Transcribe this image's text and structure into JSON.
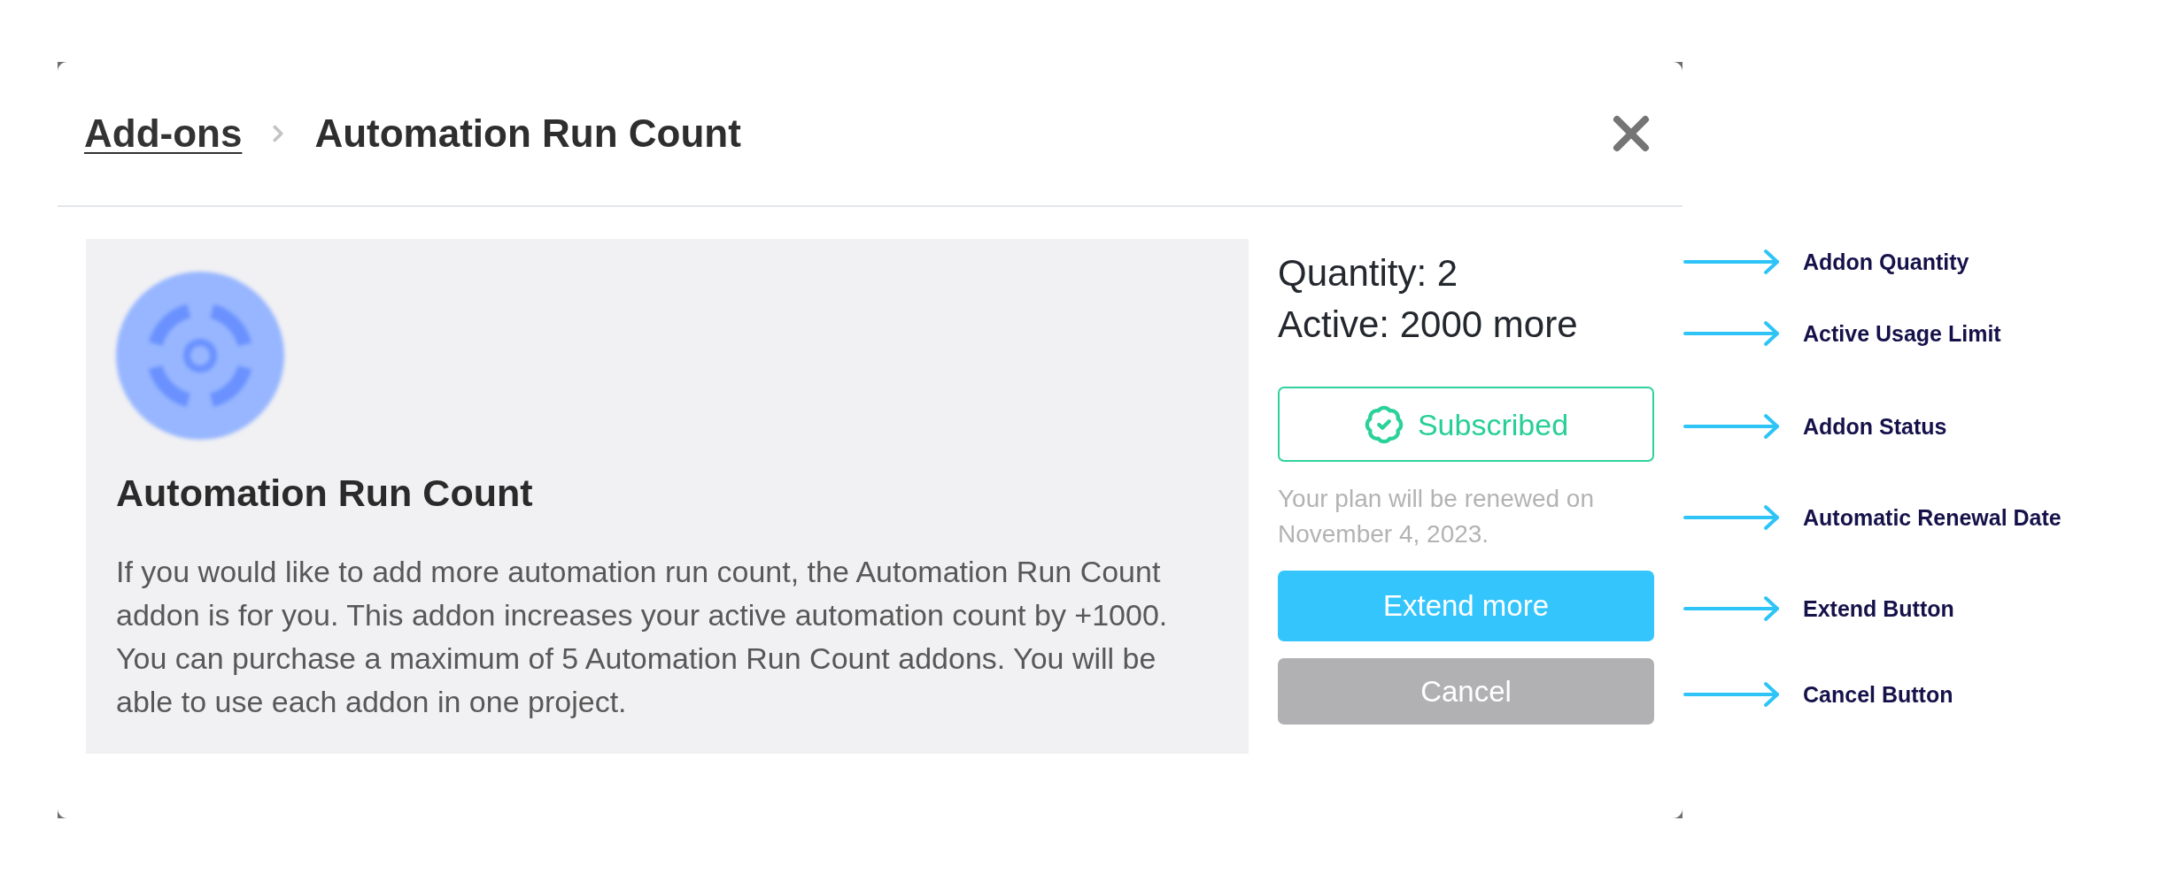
{
  "header": {
    "breadcrumb": [
      {
        "label": "Add-ons",
        "kind": "link"
      },
      {
        "label": "Automation Run Count",
        "kind": "current"
      }
    ]
  },
  "addon_card": {
    "title": "Automation Run Count",
    "description": "If you would like to add more automation run count, the Automation Run Count addon is for you. This addon increases your active automation count by +1000. You can purchase a maximum of 5 Automation Run Count addons. You will be able to use each addon in one project."
  },
  "details": {
    "quantity": "Quantity: 2",
    "active": "Active: 2000 more",
    "status": {
      "label": "Subscribed",
      "kind": "subscribed"
    },
    "renewal_note": "Your plan will be renewed on November 4, 2023.",
    "buttons": [
      {
        "label": "Extend more",
        "kind": "primary"
      },
      {
        "label": "Cancel",
        "kind": "secondary"
      }
    ]
  },
  "annotations": [
    {
      "label": "Addon Quantity"
    },
    {
      "label": "Active Usage Limit"
    },
    {
      "label": "Addon Status"
    },
    {
      "label": "Automatic Renewal Date"
    },
    {
      "label": "Extend Button"
    },
    {
      "label": "Cancel Button"
    }
  ]
}
